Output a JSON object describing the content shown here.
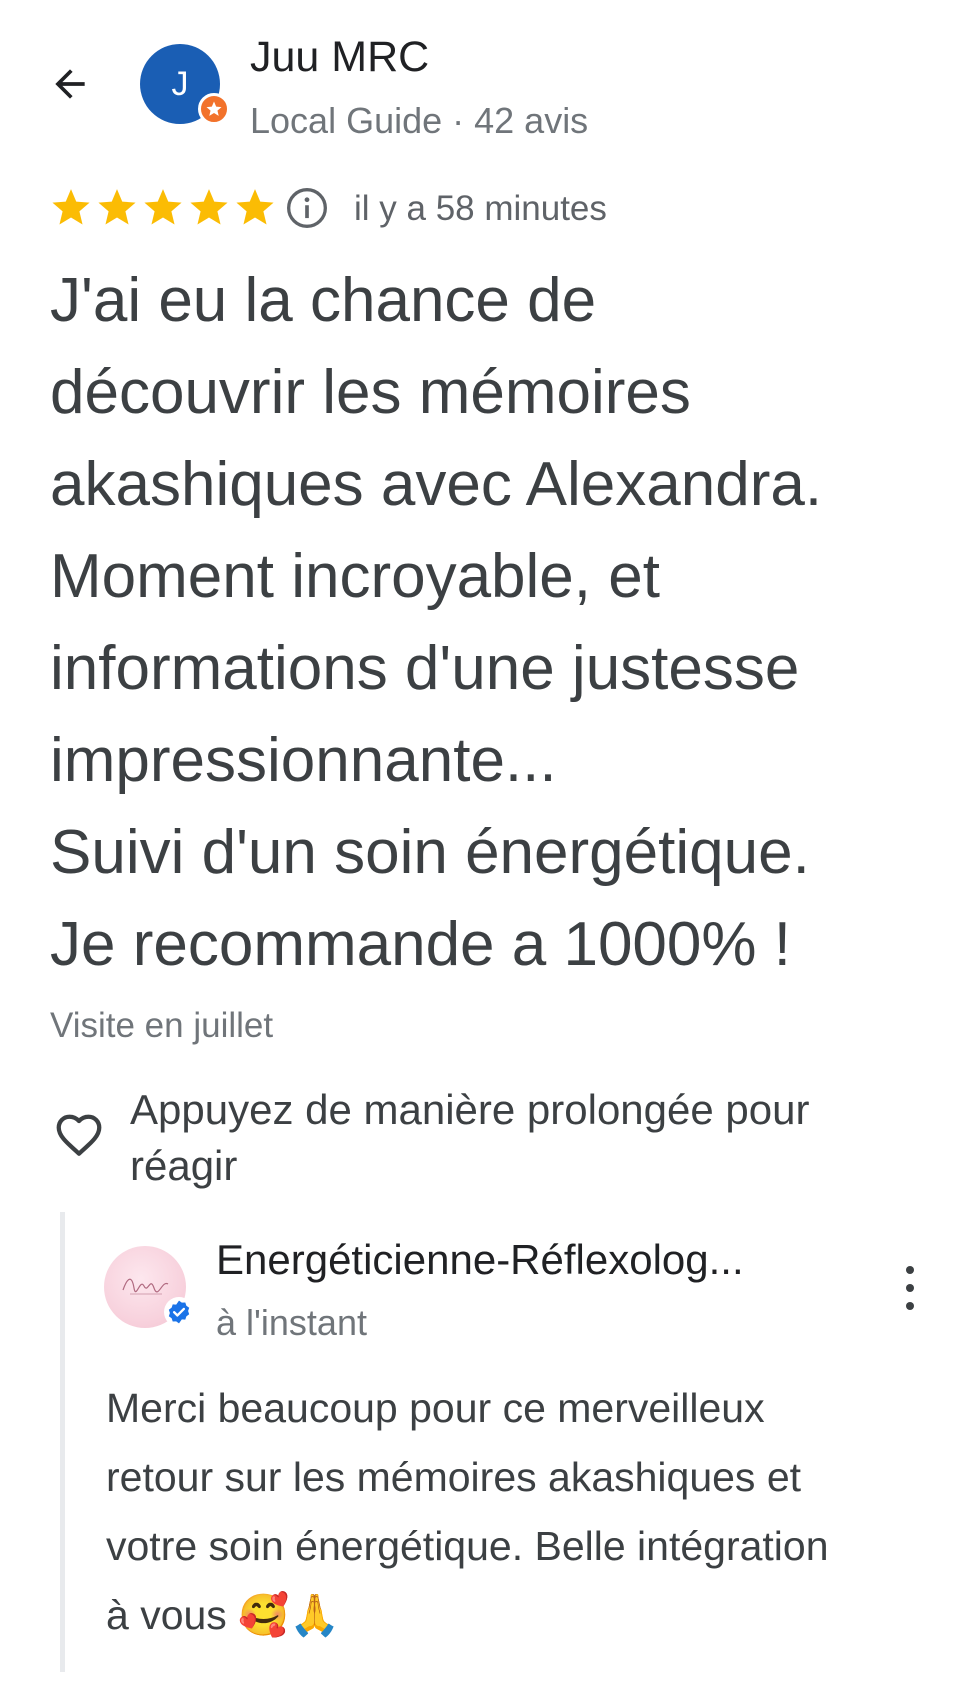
{
  "header": {
    "back_icon": "arrow-left-icon",
    "avatar_letter": "J",
    "avatar_color": "#1a5eb4",
    "badge_icon": "local-guide-star-icon",
    "badge_color": "#f2722b",
    "user_name": "Juu MRC",
    "user_meta": "Local Guide · 42 avis"
  },
  "rating": {
    "stars": 5,
    "star_color": "#fbbc04",
    "info_icon": "info-icon",
    "time": "il y a 58 minutes"
  },
  "review": {
    "lines": [
      "J'ai eu la chance de",
      "découvrir les mémoires",
      "akashiques avec Alexandra.",
      "Moment incroyable, et",
      "informations d'une justesse",
      "impressionnante...",
      "Suivi d'un soin énergétique.",
      "Je recommande a 1000% !"
    ],
    "visit": "Visite en juillet"
  },
  "react": {
    "icon": "heart-outline-icon",
    "lines": [
      "Appuyez de manière prolongée pour",
      "réagir"
    ]
  },
  "owner_reply": {
    "name": "Energéticienne-Réflexolog...",
    "time": "à l'instant",
    "verified_icon": "verified-check-icon",
    "verified_color": "#1a73e8",
    "more_icon": "more-vert-icon",
    "lines": [
      "Merci beaucoup pour ce merveilleux",
      "retour sur les mémoires akashiques et",
      "votre soin énergétique. Belle intégration",
      "à vous 🥰🙏"
    ]
  }
}
